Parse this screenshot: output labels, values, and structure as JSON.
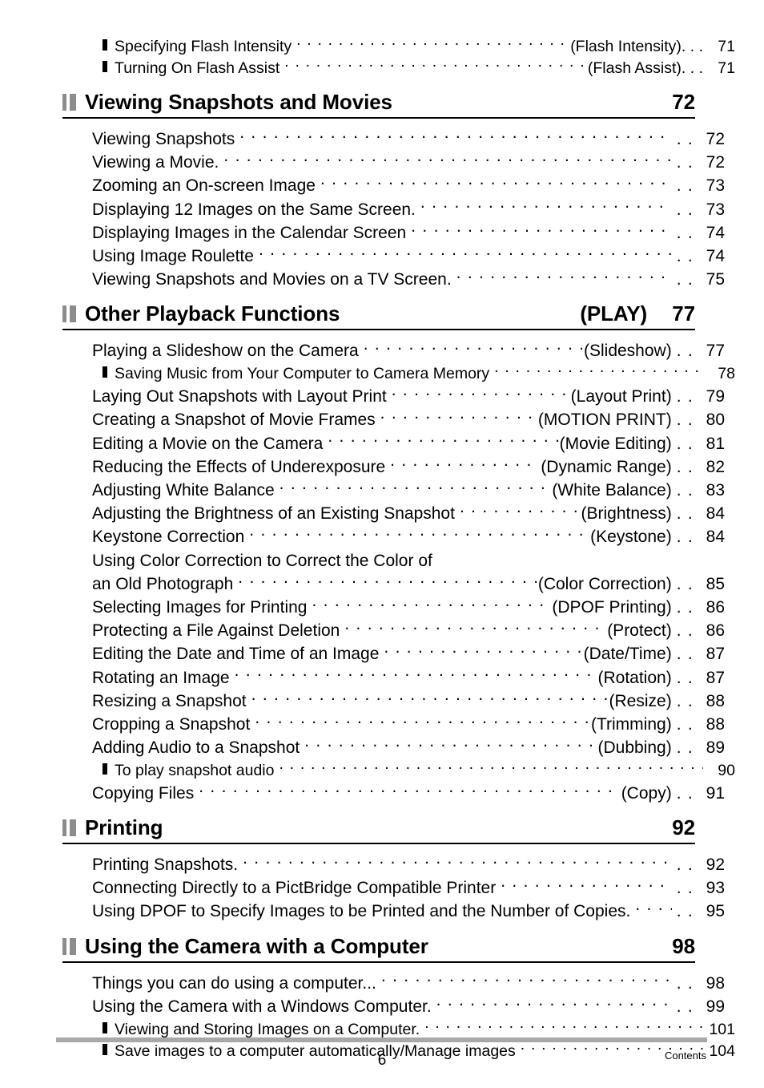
{
  "document": {
    "footer_page_number": "6",
    "footer_label": "Contents",
    "marker_color": "#8c8c8c",
    "rule_color": "#000000",
    "footer_bar_color": "#a8a8a8"
  },
  "top_subentries": [
    {
      "text": "Specifying Flash Intensity",
      "tail": "(Flash Intensity)",
      "page": "71"
    },
    {
      "text": "Turning On Flash Assist",
      "tail": "(Flash Assist)",
      "page": "71"
    }
  ],
  "sections": [
    {
      "title": "Viewing Snapshots and Movies",
      "mode": "",
      "page": "72",
      "entries": [
        {
          "level": 1,
          "text": "Viewing Snapshots",
          "tail": "",
          "page": "72"
        },
        {
          "level": 1,
          "text": "Viewing a Movie.",
          "tail": "",
          "page": "72"
        },
        {
          "level": 1,
          "text": "Zooming an On-screen Image",
          "tail": "",
          "page": "73"
        },
        {
          "level": 1,
          "text": "Displaying 12 Images on the Same Screen.",
          "tail": "",
          "page": "73"
        },
        {
          "level": 1,
          "text": "Displaying Images in the Calendar Screen",
          "tail": "",
          "page": "74"
        },
        {
          "level": 1,
          "text": "Using Image Roulette",
          "tail": "",
          "page": "74"
        },
        {
          "level": 1,
          "text": "Viewing Snapshots and Movies on a TV Screen.",
          "tail": "",
          "page": "75"
        }
      ]
    },
    {
      "title": "Other Playback Functions",
      "mode": "(PLAY)",
      "page": "77",
      "entries": [
        {
          "level": 1,
          "text": "Playing a Slideshow on the Camera",
          "tail": "(Slideshow)",
          "page": "77"
        },
        {
          "level": 2,
          "text": "Saving Music from Your Computer to Camera Memory",
          "tail": "",
          "page": "78"
        },
        {
          "level": 1,
          "text": "Laying Out Snapshots with Layout Print",
          "tail": "(Layout Print)",
          "page": "79"
        },
        {
          "level": 1,
          "text": "Creating a Snapshot of Movie Frames",
          "tail": "(MOTION PRINT)",
          "page": "80"
        },
        {
          "level": 1,
          "text": "Editing a Movie on the Camera",
          "tail": "(Movie Editing)",
          "page": "81"
        },
        {
          "level": 1,
          "text": "Reducing the Effects of Underexposure",
          "tail": "(Dynamic Range)",
          "page": "82"
        },
        {
          "level": 1,
          "text": "Adjusting White Balance",
          "tail": "(White Balance)",
          "page": "83"
        },
        {
          "level": 1,
          "text": "Adjusting the Brightness of an Existing Snapshot",
          "tail": "(Brightness)",
          "page": "84"
        },
        {
          "level": 1,
          "text": "Keystone Correction",
          "tail": "(Keystone)",
          "page": "84"
        },
        {
          "level": 0,
          "text": "Using Color Correction to Correct the Color of",
          "tail": "",
          "page": ""
        },
        {
          "level": 1,
          "text": "an Old Photograph",
          "tail": "(Color Correction)",
          "page": "85"
        },
        {
          "level": 1,
          "text": "Selecting Images for Printing",
          "tail": "(DPOF Printing)",
          "page": "86"
        },
        {
          "level": 1,
          "text": "Protecting a File Against Deletion",
          "tail": "(Protect)",
          "page": "86"
        },
        {
          "level": 1,
          "text": "Editing the Date and Time of an Image",
          "tail": "(Date/Time)",
          "page": "87"
        },
        {
          "level": 1,
          "text": "Rotating an Image",
          "tail": "(Rotation)",
          "page": "87"
        },
        {
          "level": 1,
          "text": "Resizing a Snapshot",
          "tail": "(Resize)",
          "page": "88"
        },
        {
          "level": 1,
          "text": "Cropping a Snapshot",
          "tail": "(Trimming)",
          "page": "88"
        },
        {
          "level": 1,
          "text": "Adding Audio to a Snapshot",
          "tail": "(Dubbing)",
          "page": "89"
        },
        {
          "level": 2,
          "text": "To play snapshot audio",
          "tail": "",
          "page": "90"
        },
        {
          "level": 1,
          "text": "Copying Files",
          "tail": "(Copy)",
          "page": "91"
        }
      ]
    },
    {
      "title": "Printing",
      "mode": "",
      "page": "92",
      "entries": [
        {
          "level": 1,
          "text": "Printing Snapshots.",
          "tail": "",
          "page": "92"
        },
        {
          "level": 1,
          "text": "Connecting Directly to a PictBridge Compatible Printer",
          "tail": "",
          "page": "93"
        },
        {
          "level": 1,
          "text": "Using DPOF to Specify Images to be Printed and the Number of Copies.",
          "tail": "",
          "page": "95"
        }
      ]
    },
    {
      "title": "Using the Camera with a Computer",
      "mode": "",
      "page": "98",
      "entries": [
        {
          "level": 1,
          "text": "Things you can do using a computer...",
          "tail": "",
          "page": "98"
        },
        {
          "level": 1,
          "text": "Using the Camera with a Windows Computer.",
          "tail": "",
          "page": "99"
        },
        {
          "level": 2,
          "text": "Viewing and Storing Images on a Computer.",
          "tail": "",
          "page": "101"
        },
        {
          "level": 2,
          "text": "Save images to a computer automatically/Manage images",
          "tail": "",
          "page": "104"
        }
      ]
    }
  ]
}
